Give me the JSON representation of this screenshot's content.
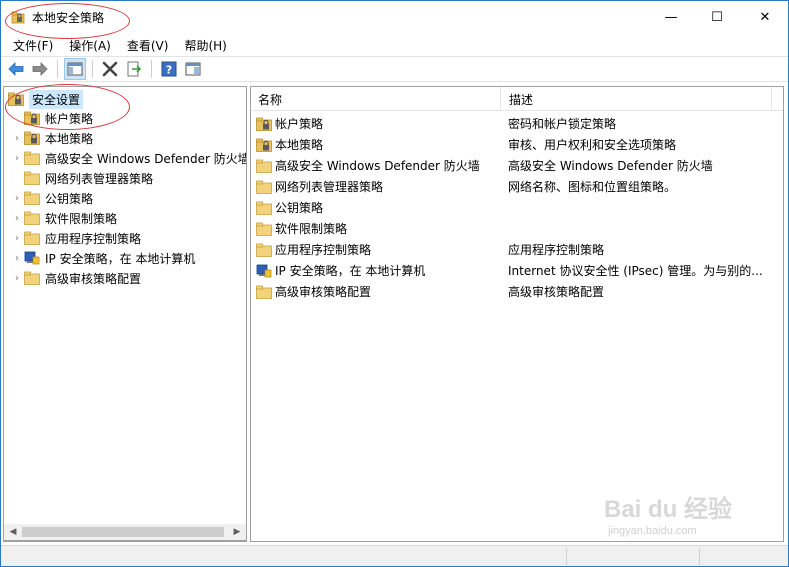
{
  "window": {
    "title": "本地安全策略",
    "controls": {
      "minimize": "—",
      "maximize": "☐",
      "close": "✕"
    }
  },
  "menubar": {
    "items": [
      {
        "label": "文件(F)"
      },
      {
        "label": "操作(A)"
      },
      {
        "label": "查看(V)"
      },
      {
        "label": "帮助(H)"
      }
    ]
  },
  "toolbar": {
    "buttons": [
      {
        "icon": "back-arrow-icon"
      },
      {
        "icon": "forward-arrow-icon"
      },
      {
        "icon": "show-hide-console-tree-icon",
        "pressed": true
      },
      {
        "icon": "delete-icon"
      },
      {
        "icon": "export-list-icon"
      },
      {
        "icon": "help-icon"
      },
      {
        "icon": "properties-pane-icon"
      }
    ]
  },
  "tree": {
    "root": {
      "label": "安全设置",
      "icon": "shield-folder-icon"
    },
    "items": [
      {
        "label": "帐户策略",
        "icon": "shield-folder-icon",
        "expander": ""
      },
      {
        "label": "本地策略",
        "icon": "shield-folder-icon",
        "expander": "›"
      },
      {
        "label": "高级安全 Windows Defender 防火墙",
        "icon": "folder-icon",
        "expander": "›"
      },
      {
        "label": "网络列表管理器策略",
        "icon": "folder-icon",
        "expander": ""
      },
      {
        "label": "公钥策略",
        "icon": "folder-icon",
        "expander": "›"
      },
      {
        "label": "软件限制策略",
        "icon": "folder-icon",
        "expander": "›"
      },
      {
        "label": "应用程序控制策略",
        "icon": "folder-icon",
        "expander": "›"
      },
      {
        "label": "IP 安全策略，在 本地计算机",
        "icon": "ipsec-icon",
        "expander": "›"
      },
      {
        "label": "高级审核策略配置",
        "icon": "folder-icon",
        "expander": "›"
      }
    ]
  },
  "list": {
    "columns": {
      "name": "名称",
      "description": "描述"
    },
    "rows": [
      {
        "name": "帐户策略",
        "description": "密码和帐户锁定策略",
        "icon": "shield-folder-icon"
      },
      {
        "name": "本地策略",
        "description": "审核、用户权利和安全选项策略",
        "icon": "shield-folder-icon"
      },
      {
        "name": "高级安全 Windows Defender 防火墙",
        "description": "高级安全 Windows Defender 防火墙",
        "icon": "folder-icon"
      },
      {
        "name": "网络列表管理器策略",
        "description": "网络名称、图标和位置组策略。",
        "icon": "folder-icon"
      },
      {
        "name": "公钥策略",
        "description": "",
        "icon": "folder-icon"
      },
      {
        "name": "软件限制策略",
        "description": "",
        "icon": "folder-icon"
      },
      {
        "name": "应用程序控制策略",
        "description": "应用程序控制策略",
        "icon": "folder-icon"
      },
      {
        "name": "IP 安全策略，在 本地计算机",
        "description": "Internet 协议安全性 (IPsec) 管理。为与别的...",
        "icon": "ipsec-icon"
      },
      {
        "name": "高级审核策略配置",
        "description": "高级审核策略配置",
        "icon": "folder-icon"
      }
    ]
  },
  "watermark": {
    "brand": "Bai du 经验",
    "url": "jingyan.baidu.com"
  },
  "colors": {
    "accent": "#2b78c9",
    "selection": "#cce8ff",
    "folder": "#e8c15a",
    "annotation": "#d9383f"
  }
}
